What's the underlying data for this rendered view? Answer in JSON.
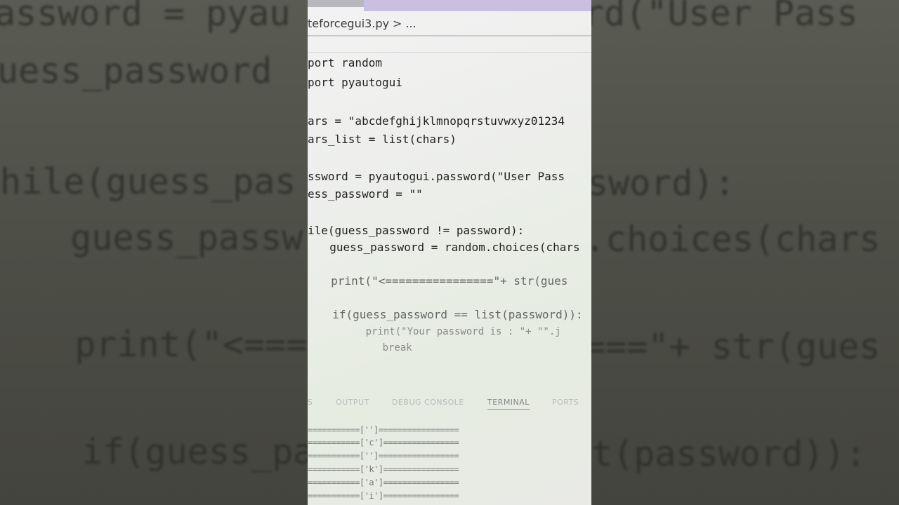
{
  "breadcrumb": {
    "file": "teforcegui3.py",
    "sep": ">",
    "more": "..."
  },
  "code_lines": [
    "port random",
    "port pyautogui",
    "",
    "ars = \"abcdefghijklmnopqrstuvwxyz01234",
    "ars_list = list(chars)",
    "",
    "ssword = pyautogui.password(\"User Pass",
    "ess_password = \"\"",
    "",
    "ile(guess_password != password):",
    "  guess_password = random.choices(chars",
    "",
    "  print(\"<================\"+ str(gues",
    "",
    "  if(guess_password == list(password)):",
    "      print(\"Your password is : \"+ \"\".j",
    "      break"
  ],
  "panel_tabs": [
    "S",
    "OUTPUT",
    "DEBUG CONSOLE",
    "TERMINAL",
    "PORTS"
  ],
  "terminal_lines": [
    "===========['']=================",
    "===========['c']================",
    "===========['']=================",
    "===========['k']================",
    "===========['a']================",
    "===========['i']================"
  ],
  "background_left": [
    "assword = pyau",
    "uess_password",
    "hile(guess_pas",
    "  guess_passw",
    "  print(\"<===",
    "  if(guess_pa"
  ],
  "background_right": [
    "rd(\"User Pass",
    "sword):",
    ".choices(chars",
    "===\"+ str(gues",
    "st(password)):"
  ]
}
